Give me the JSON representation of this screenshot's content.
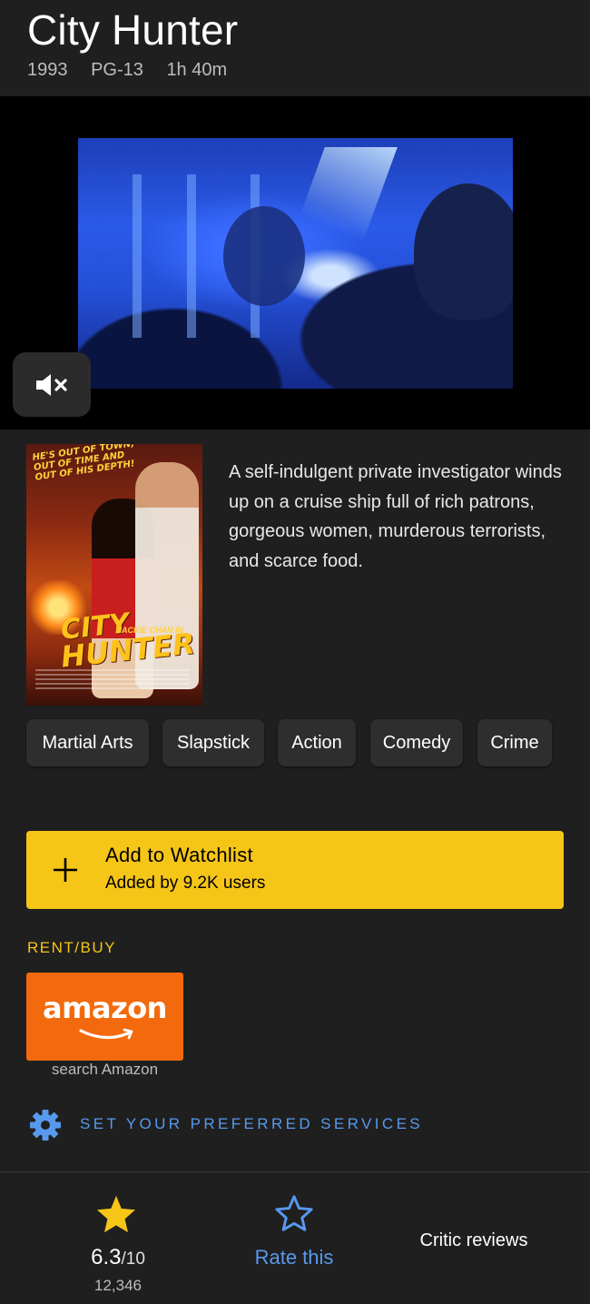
{
  "title": {
    "name": "City Hunter",
    "year": "1993",
    "rating_cert": "PG-13",
    "runtime": "1h 40m"
  },
  "video": {
    "mute_icon": "volume-mute-icon"
  },
  "poster": {
    "tagline": [
      "HE'S OUT OF TOWN,",
      "OUT OF TIME AND",
      "OUT OF HIS DEPTH!"
    ],
    "logo_line1": "CITY",
    "logo_line2": "HUNTER",
    "star": "JACKIE CHAN IN"
  },
  "description": "A self-indulgent private investigator winds up on a cruise ship full of rich patrons, gorgeous women, murderous terrorists, and scarce food.",
  "genres": [
    "Martial Arts",
    "Slapstick",
    "Action",
    "Comedy",
    "Crime"
  ],
  "watchlist": {
    "icon": "plus-icon",
    "label": "Add to Watchlist",
    "sub": "Added by 9.2K users"
  },
  "rent_buy": {
    "heading": "RENT/BUY",
    "provider_logo": "amazon",
    "provider_sub": "search Amazon"
  },
  "services": {
    "icon": "gear-icon",
    "label": "SET YOUR PREFERRED SERVICES"
  },
  "bottom_bar": {
    "rating_icon": "star-filled-icon",
    "rating_value": "6.3",
    "rating_max": "/10",
    "rating_count": "12,346",
    "rate_icon": "star-outline-icon",
    "rate_label": "Rate this",
    "critic_label": "Critic reviews"
  },
  "colors": {
    "accent_yellow": "#f5c518",
    "link_blue": "#5799ef",
    "background": "#1f1f1f",
    "amazon_orange": "#f26a0d"
  }
}
